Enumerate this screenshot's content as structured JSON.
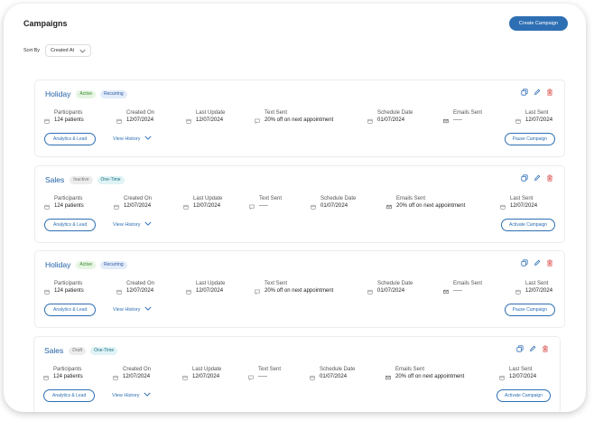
{
  "header": {
    "title": "Campaigns",
    "create_label": "Create Campaign"
  },
  "sort": {
    "label": "Sort By",
    "value": "Created At"
  },
  "labels": {
    "participants": "Participants",
    "created_on": "Created On",
    "last_update": "Last Update",
    "text_sent": "Text Sent",
    "schedule_date": "Schedule Date",
    "emails_sent": "Emails Sent",
    "last_sent": "Last Sent",
    "analytics": "Analytics & Lead",
    "view_history": "View History"
  },
  "campaigns": [
    {
      "name": "Holiday",
      "status": "Active",
      "type": "Recurring",
      "participants": "124 patients",
      "created_on": "12/07/2024",
      "last_update": "12/07/2024",
      "text_sent": "20% off on next appointment",
      "schedule_date": "01/07/2024",
      "emails_sent": "-----",
      "last_sent": "12/07/2024",
      "action": "Pause Campaign"
    },
    {
      "name": "Sales",
      "status": "Inactive",
      "type": "One-Time",
      "participants": "124 patients",
      "created_on": "12/07/2024",
      "last_update": "12/07/2024",
      "text_sent": "-----",
      "schedule_date": "01/07/2024",
      "emails_sent": "20% off on next appointment",
      "last_sent": "12/07/2024",
      "action": "Activate Campaign"
    },
    {
      "name": "Holiday",
      "status": "Active",
      "type": "Recurring",
      "participants": "124 patients",
      "created_on": "12/07/2024",
      "last_update": "12/07/2024",
      "text_sent": "20% off on next appointment",
      "schedule_date": "01/07/2024",
      "emails_sent": "-----",
      "last_sent": "12/07/2024",
      "action": "Pause Campaign"
    },
    {
      "name": "Sales",
      "status": "Draft",
      "type": "One-Time",
      "participants": "124 patients",
      "created_on": "12/07/2024",
      "last_update": "12/07/2024",
      "text_sent": "-----",
      "schedule_date": "01/07/2024",
      "emails_sent": "20% off on next appointment",
      "last_sent": "12/07/2024",
      "action": "Activate Campaign"
    }
  ],
  "icons": {
    "copy": "copy-icon",
    "edit": "pencil-icon",
    "delete": "trash-icon",
    "calendar": "calendar-icon",
    "message": "message-icon",
    "mail": "mail-icon",
    "chevron": "chevron-down-icon"
  },
  "colors": {
    "primary": "#2e6fb4",
    "delete": "#d9534f"
  }
}
